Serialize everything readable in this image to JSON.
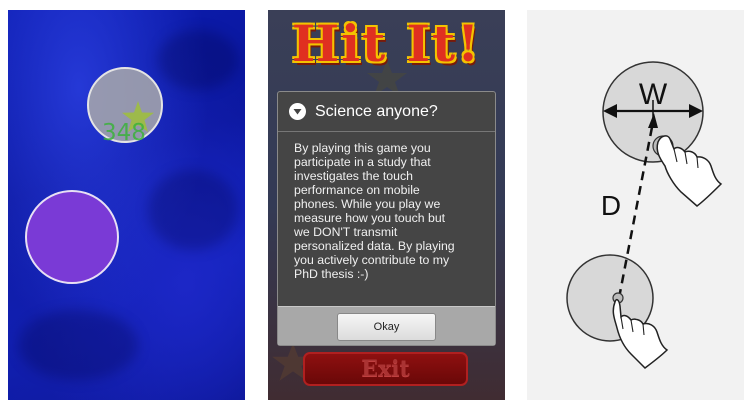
{
  "game_screen": {
    "score": "348"
  },
  "dialog_screen": {
    "game_title": "Hit It!",
    "dialog": {
      "title": "Science anyone?",
      "body_lines": [
        "By playing this game you",
        "participate in a study that",
        "investigates the touch",
        "performance on mobile",
        "phones. While you play we",
        "measure how you touch but",
        "we DON'T transmit",
        "personalized data. By playing",
        "you actively contribute to my",
        "PhD thesis :-)"
      ],
      "okay_label": "Okay"
    },
    "exit_label": "Exit"
  },
  "diagram": {
    "width_label": "W",
    "distance_label": "D"
  },
  "colors": {
    "game_background": "#0c1cb0",
    "target_circle": "#aaaaaa",
    "start_circle": "#7a3ad6",
    "score_green": "#3bb23b",
    "dialog_background": "#454545",
    "title_red": "#e03020",
    "title_yellow": "#f3c300"
  },
  "icons": {
    "star": "star-icon",
    "dialog": "dialog-chevron-icon",
    "hand": "pointing-hand-icon"
  }
}
